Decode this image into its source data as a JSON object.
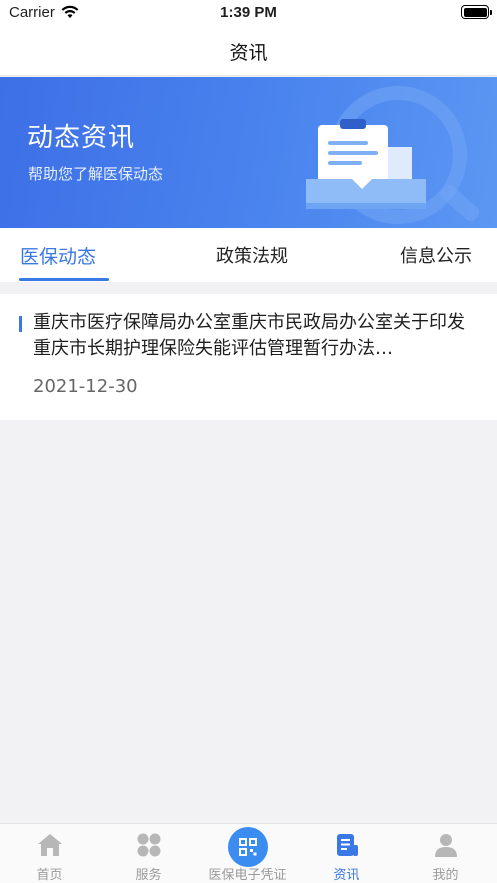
{
  "status_bar": {
    "carrier": "Carrier",
    "time": "1:39 PM"
  },
  "nav": {
    "title": "资讯"
  },
  "banner": {
    "title": "动态资讯",
    "subtitle": "帮助您了解医保动态"
  },
  "tabs": [
    {
      "label": "医保动态",
      "active": true
    },
    {
      "label": "政策法规",
      "active": false
    },
    {
      "label": "信息公示",
      "active": false
    }
  ],
  "news": [
    {
      "title": "重庆市医疗保障局办公室重庆市民政局办公室关于印发重庆市长期护理保险失能评估管理暂行办法…",
      "date": "2021-12-30"
    }
  ],
  "tab_bar": [
    {
      "label": "首页",
      "icon": "home-icon",
      "active": false
    },
    {
      "label": "服务",
      "icon": "grid-icon",
      "active": false
    },
    {
      "label": "医保电子凭证",
      "icon": "qr-code-icon",
      "active": false
    },
    {
      "label": "资讯",
      "icon": "news-icon",
      "active": true
    },
    {
      "label": "我的",
      "icon": "user-icon",
      "active": false
    }
  ],
  "colors": {
    "accent": "#3a78e6",
    "banner": "#4a84ee",
    "inactive": "#9a9a9a"
  }
}
